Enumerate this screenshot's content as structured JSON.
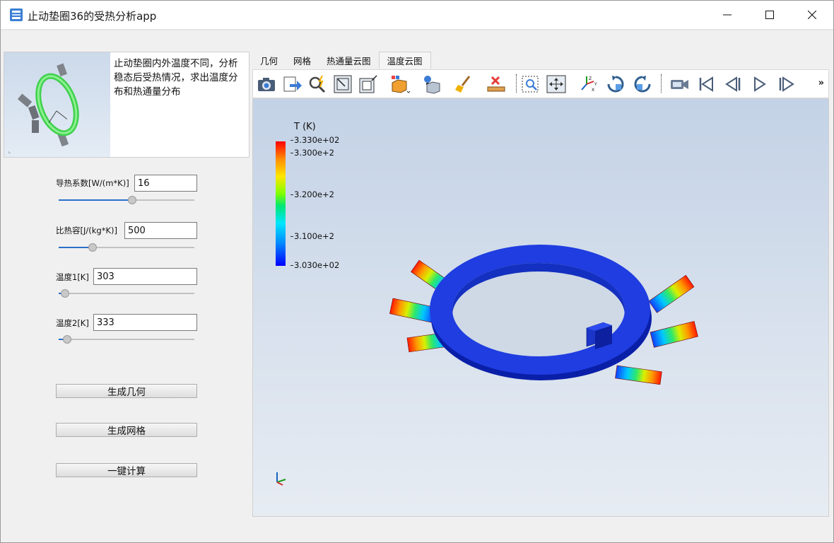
{
  "window": {
    "title": "止动垫圈36的受热分析app",
    "minimize_icon": "minimize-icon",
    "maximize_icon": "maximize-icon",
    "close_icon": "close-icon"
  },
  "preview": {
    "description": "止动垫圈内外温度不同，分析稳态后受热情况，求出温度分布和热通量分布"
  },
  "params": [
    {
      "label": "导热系数[W/(m*K)]",
      "value": "16",
      "slider_fraction": 0.5
    },
    {
      "label": "比热容[J/(kg*K)]",
      "value": "500",
      "slider_fraction": 0.25
    },
    {
      "label": "温度1[K]",
      "value": "303",
      "slider_fraction": 0.04
    },
    {
      "label": "温度2[K]",
      "value": "333",
      "slider_fraction": 0.06
    }
  ],
  "buttons": {
    "gen_geometry": "生成几何",
    "gen_mesh": "生成网格",
    "compute": "一键计算"
  },
  "tabs": [
    {
      "label": "几何",
      "active": false
    },
    {
      "label": "网格",
      "active": false
    },
    {
      "label": "热通量云图",
      "active": false
    },
    {
      "label": "温度云图",
      "active": true
    }
  ],
  "toolbar": {
    "icons": [
      "camera-icon",
      "export-icon",
      "zoom-select-icon",
      "zoom-extents-icon",
      "zoom-window-icon",
      "view-style-icon",
      "light-icon",
      "clear-icon",
      "measure-icon",
      "zoom-box-icon",
      "pan-icon",
      "axes-icon",
      "rotate-cw-icon",
      "rotate-ccw-icon",
      "record-icon",
      "first-frame-icon",
      "prev-frame-icon",
      "play-icon",
      "next-frame-icon"
    ],
    "more": "»"
  },
  "legend": {
    "title": "T (K)",
    "ticks": [
      "3.330e+02",
      "3.300e+2",
      "3.200e+2",
      "3.100e+2",
      "3.030e+02"
    ],
    "tick_values": [
      333,
      330,
      320,
      310,
      303
    ],
    "min": 303,
    "max": 333,
    "colors": [
      "#0000ff",
      "#00e5ff",
      "#00e676",
      "#ffe600",
      "#ff0000"
    ]
  }
}
